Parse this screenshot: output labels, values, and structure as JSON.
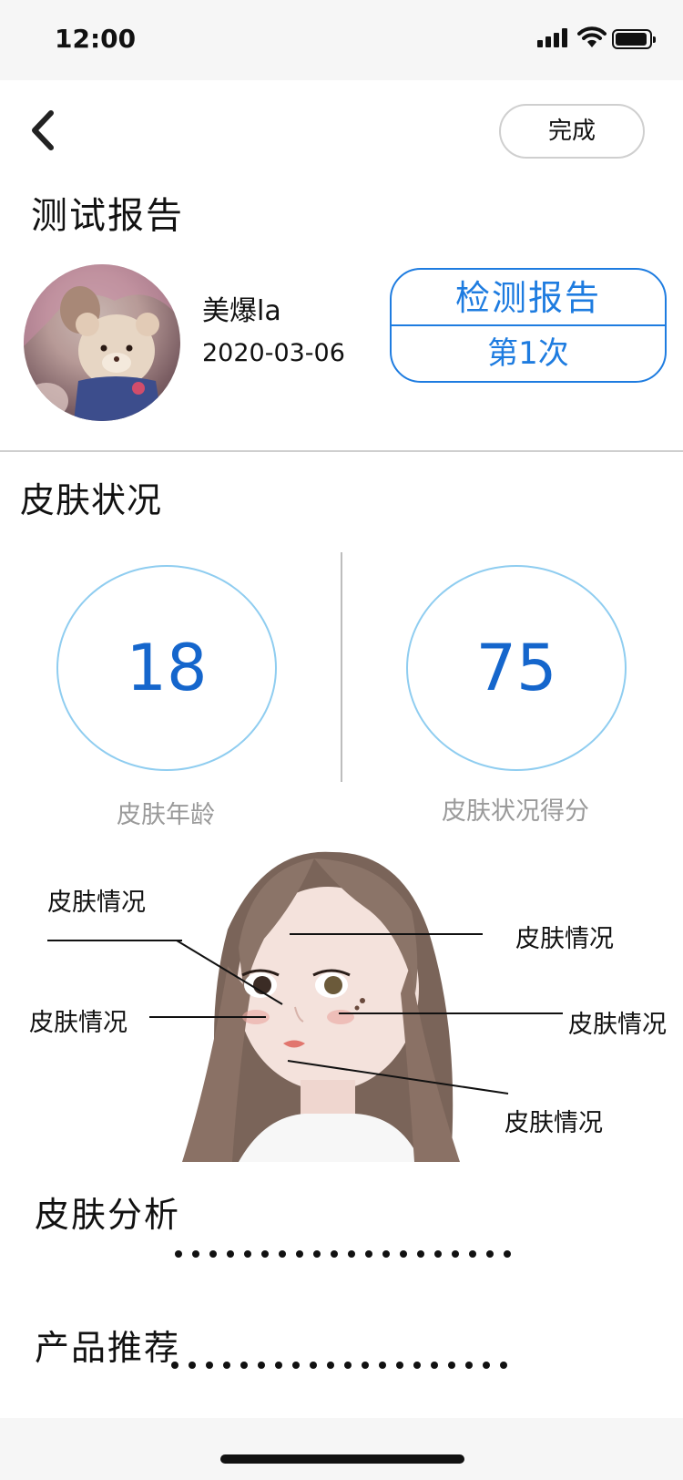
{
  "status_bar": {
    "time": "12:00",
    "signal_icon": "signal-icon",
    "wifi_icon": "wifi-icon",
    "battery_icon": "battery-icon"
  },
  "nav": {
    "back_icon": "chevron-left-icon",
    "done_label": "完成"
  },
  "page_title": "测试报告",
  "profile": {
    "name": "美爆la",
    "date": "2020-03-06"
  },
  "report_badge": {
    "title": "检测报告",
    "count": "第1次"
  },
  "skin_status": {
    "title": "皮肤状况",
    "metrics": [
      {
        "value": "18",
        "label": "皮肤年龄"
      },
      {
        "value": "75",
        "label": "皮肤状况得分"
      }
    ]
  },
  "face_callouts": [
    "皮肤情况",
    "皮肤情况",
    "皮肤情况",
    "皮肤情况",
    "皮肤情况"
  ],
  "analysis": {
    "title": "皮肤分析"
  },
  "products": {
    "title": "产品推荐"
  },
  "colors": {
    "accent": "#1e7ce0",
    "metric_number": "#1566cc",
    "circle_border": "#8fcdf0",
    "muted_text": "#9a9a9a"
  }
}
